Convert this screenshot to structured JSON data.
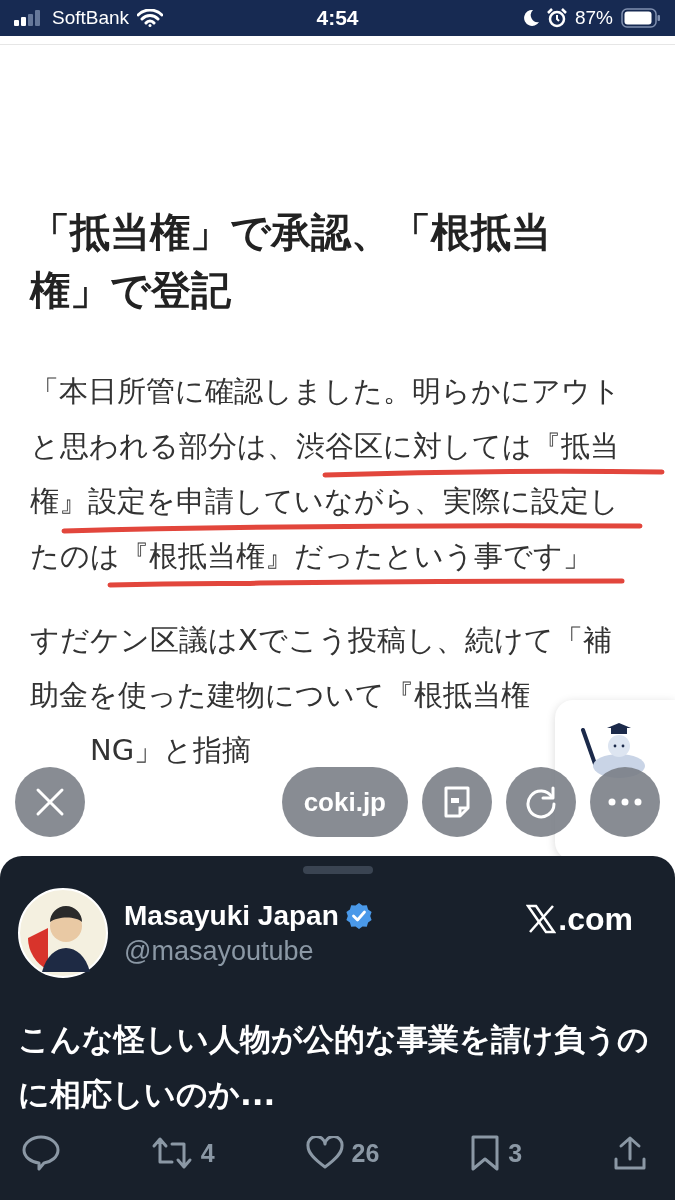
{
  "status_bar": {
    "carrier": "SoftBank",
    "time": "4:54",
    "battery": "87%"
  },
  "article": {
    "heading_lines": [
      "「抵当権」で承認、「根抵当",
      "権」で登記"
    ],
    "paragraphs": [
      {
        "lines": [
          "「本日所管に確認しました。明らかにアウト",
          "と思われる部分は、渋谷区に対しては『抵当",
          "権』設定を申請していながら、実際に設定し",
          "たのは『根抵当権』だったという事です」"
        ]
      },
      {
        "lines": [
          "すだケン区議はXでこう投稿し、続けて「補",
          "助金を使った建物について『根抵当権",
          "NG」と指摘"
        ]
      }
    ]
  },
  "toolbar": {
    "site": "coki.jp"
  },
  "tweet": {
    "name": "Masayuki Japan",
    "verified": true,
    "handle": "@masayoutube",
    "source": ".com",
    "text_lines": [
      "こんな怪しい人物が公的な事業を請け負うの",
      "に相応しいのか..."
    ],
    "actions": [
      {
        "kind": "reply"
      },
      {
        "kind": "repost",
        "count": "4"
      },
      {
        "kind": "like",
        "count": "26"
      },
      {
        "kind": "bookmark",
        "count": "3"
      },
      {
        "kind": "share"
      }
    ]
  }
}
